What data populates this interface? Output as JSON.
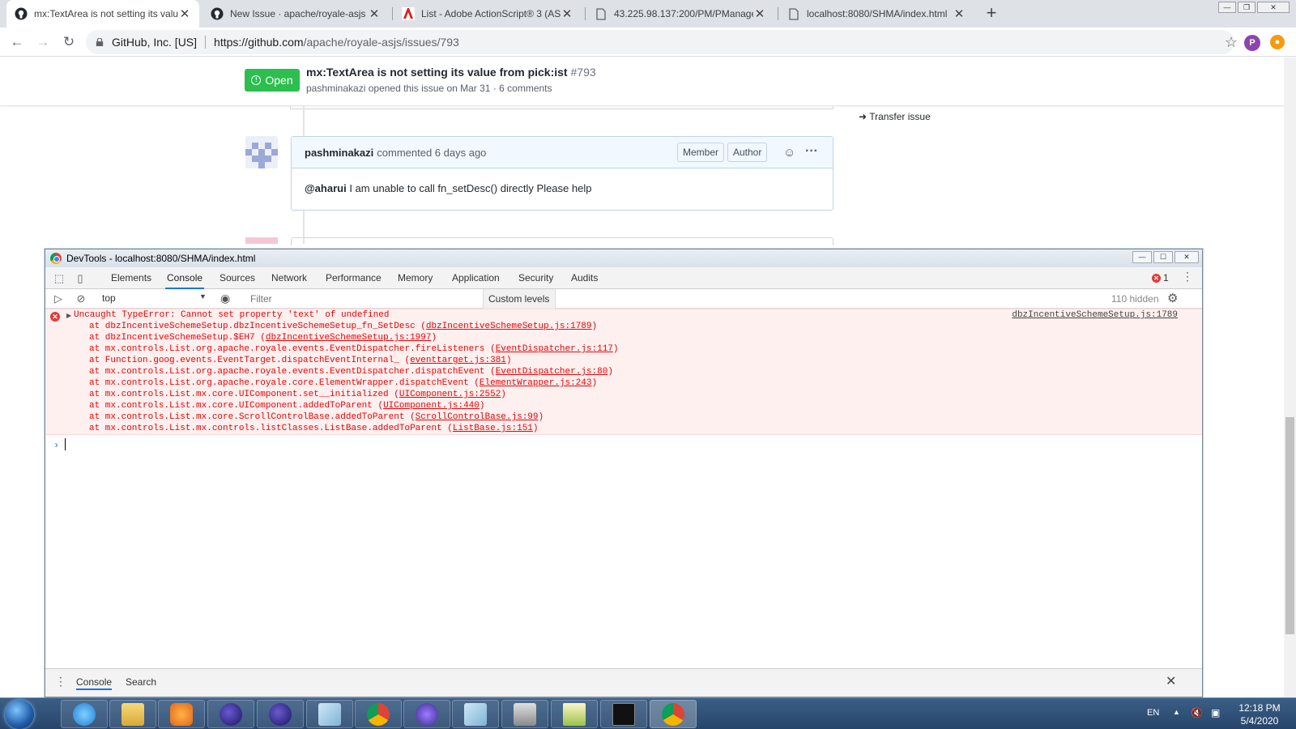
{
  "tabs": [
    {
      "title": "mx:TextArea is not setting its valu",
      "icon": "github-icon",
      "active": true
    },
    {
      "title": "New Issue · apache/royale-asjs",
      "icon": "github-icon",
      "active": false
    },
    {
      "title": "List - Adobe ActionScript® 3 (AS",
      "icon": "adobe-icon",
      "active": false
    },
    {
      "title": "43.225.98.137:200/PM/PManager",
      "icon": "document-icon",
      "active": false
    },
    {
      "title": "localhost:8080/SHMA/index.html",
      "icon": "document-icon",
      "active": false
    }
  ],
  "address": {
    "site_identity": "GitHub, Inc. [US]",
    "url_host": "https://github.com",
    "url_path": "/apache/royale-asjs/issues/793",
    "profile_initial": "P"
  },
  "issue": {
    "state": "Open",
    "title": "mx:TextArea is not setting its value from pick:ist",
    "number": "#793",
    "author": "pashminakazi",
    "meta_rest": "opened this issue on Mar 31 · 6 comments",
    "transfer_label": "Transfer issue"
  },
  "comment": {
    "author": "pashminakazi",
    "when": "commented 6 days ago",
    "badges": [
      "Member",
      "Author"
    ],
    "mention": "@aharui",
    "body": " I am unable to call fn_setDesc() directly Please help"
  },
  "devtools": {
    "title": "DevTools - localhost:8080/SHMA/index.html",
    "tabs": [
      "Elements",
      "Console",
      "Sources",
      "Network",
      "Performance",
      "Memory",
      "Application",
      "Security",
      "Audits"
    ],
    "active_tab": "Console",
    "error_count": "1",
    "context": "top",
    "filter_placeholder": "Filter",
    "levels": "Custom levels ▾",
    "hidden": "110 hidden",
    "error": {
      "message": "Uncaught TypeError: Cannot set property 'text' of undefined",
      "source": "dbzIncentiveSchemeSetup.js:1789",
      "stack": [
        {
          "fn": "at dbzIncentiveSchemeSetup.dbzIncentiveSchemeSetup_fn_SetDesc",
          "link": "dbzIncentiveSchemeSetup.js:1789"
        },
        {
          "fn": "at dbzIncentiveSchemeSetup.$EH7",
          "link": "dbzIncentiveSchemeSetup.js:1997"
        },
        {
          "fn": "at mx.controls.List.org.apache.royale.events.EventDispatcher.fireListeners",
          "link": "EventDispatcher.js:117"
        },
        {
          "fn": "at Function.goog.events.EventTarget.dispatchEventInternal_",
          "link": "eventtarget.js:381"
        },
        {
          "fn": "at mx.controls.List.org.apache.royale.events.EventDispatcher.dispatchEvent",
          "link": "EventDispatcher.js:80"
        },
        {
          "fn": "at mx.controls.List.org.apache.royale.core.ElementWrapper.dispatchEvent",
          "link": "ElementWrapper.js:243"
        },
        {
          "fn": "at mx.controls.List.mx.core.UIComponent.set__initialized",
          "link": "UIComponent.js:2552"
        },
        {
          "fn": "at mx.controls.List.mx.core.UIComponent.addedToParent",
          "link": "UIComponent.js:440"
        },
        {
          "fn": "at mx.controls.List.mx.core.ScrollControlBase.addedToParent",
          "link": "ScrollControlBase.js:99"
        },
        {
          "fn": "at mx.controls.List.mx.controls.listClasses.ListBase.addedToParent",
          "link": "ListBase.js:151"
        }
      ]
    },
    "drawer_tabs": [
      "Console",
      "Search"
    ]
  },
  "taskbar": {
    "apps": [
      "internet-explorer-icon",
      "file-explorer-icon",
      "media-player-icon",
      "eclipse-icon",
      "eclipse-icon",
      "notepad-icon",
      "chrome-icon",
      "visual-studio-icon",
      "notepad-icon",
      "installer-icon",
      "chart-app-icon",
      "command-prompt-icon",
      "chrome-icon"
    ],
    "language": "EN",
    "time": "12:18 PM",
    "date": "5/4/2020"
  },
  "colors": {
    "open_green": "#2cbe4e",
    "error_red": "#e00",
    "error_bg": "#fff0f0",
    "devtools_accent": "#1a73e8"
  }
}
